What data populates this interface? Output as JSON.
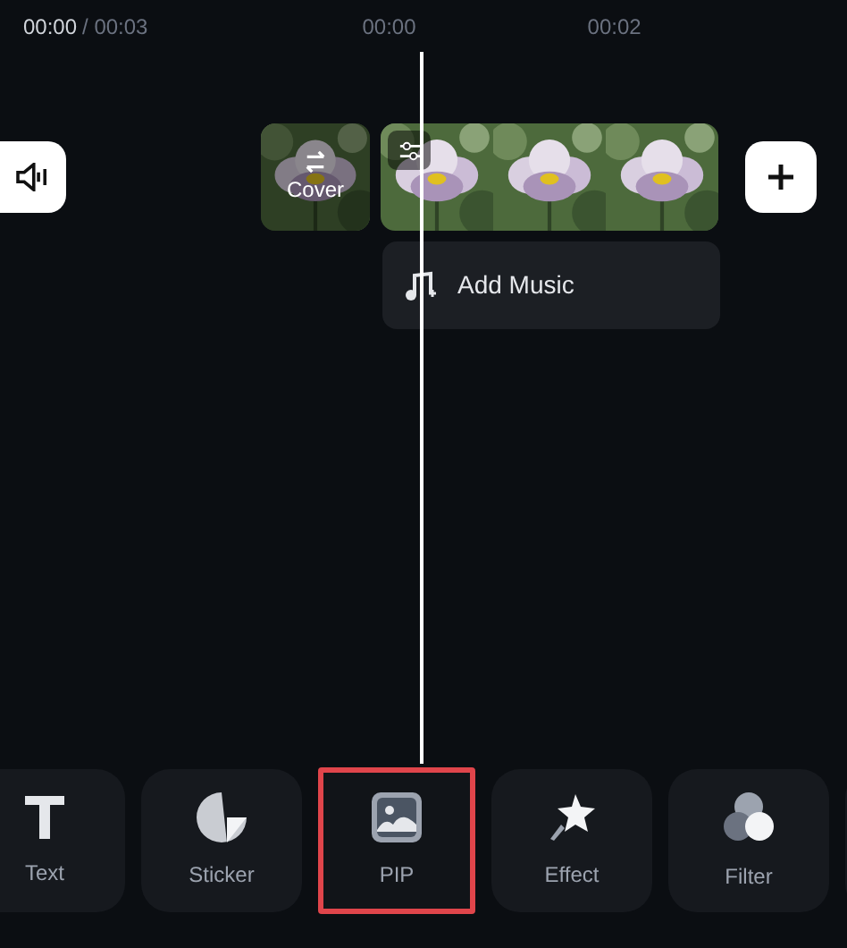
{
  "timeline": {
    "current": "00:00",
    "total": "/ 00:03",
    "ruler": [
      "00:00",
      "00:02"
    ]
  },
  "clips": {
    "cover_label": "Cover"
  },
  "music": {
    "label": "Add Music"
  },
  "tools": [
    {
      "label": "Text",
      "kind": "text",
      "selected": false
    },
    {
      "label": "Sticker",
      "kind": "sticker",
      "selected": false
    },
    {
      "label": "PIP",
      "kind": "pip",
      "selected": true
    },
    {
      "label": "Effect",
      "kind": "effect",
      "selected": false
    },
    {
      "label": "Filter",
      "kind": "filter",
      "selected": false
    }
  ]
}
